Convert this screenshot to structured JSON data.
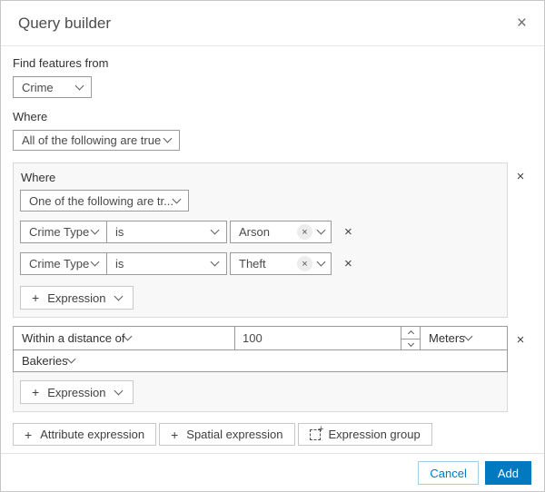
{
  "dialog": {
    "title": "Query builder"
  },
  "icons": {
    "close": "×",
    "remove": "×",
    "plus": "+",
    "chip_remove": "×"
  },
  "labels": {
    "find_features_from": "Find features from",
    "where_top": "Where",
    "where_group": "Where"
  },
  "source_select": {
    "value": "Crime"
  },
  "top_operator_select": {
    "value": "All of the following are true"
  },
  "group1": {
    "operator_select": {
      "value": "One of the following are tr..."
    },
    "rows": [
      {
        "field": "Crime Type",
        "operator": "is",
        "value": "Arson"
      },
      {
        "field": "Crime Type",
        "operator": "is",
        "value": "Theft"
      }
    ],
    "add_expression_label": "Expression"
  },
  "group2": {
    "type_select": {
      "value": "Within a distance of"
    },
    "distance_input": {
      "value": "100"
    },
    "unit_select": {
      "value": "Meters"
    },
    "layer_select": {
      "value": "Bakeries"
    },
    "add_expression_label": "Expression"
  },
  "bottom_buttons": {
    "attribute_expression": "Attribute expression",
    "spatial_expression": "Spatial expression",
    "expression_group": "Expression group"
  },
  "actions": {
    "cancel": "Cancel",
    "add": "Add"
  },
  "colors": {
    "accent_blue": "#0079c1",
    "group_bg": "#f8f8f8",
    "border_input": "#9b9b9b"
  }
}
